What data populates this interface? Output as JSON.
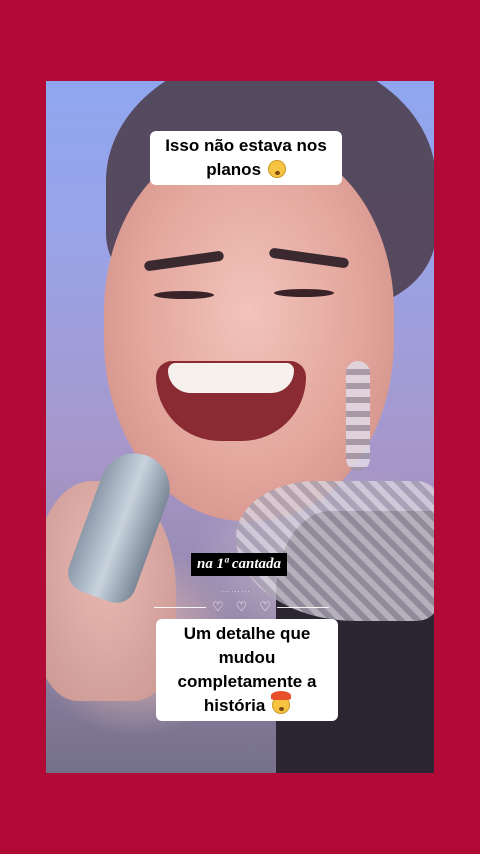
{
  "video": {
    "caption_top": "Isso não estava nos planos",
    "caption_top_emoji": "flushed-face",
    "subtitle": "na 1ª cantada",
    "caption_bottom": "Um detalhe que mudou completamente a história",
    "caption_bottom_emoji": "exploding-head"
  },
  "colors": {
    "background": "#b10a36",
    "caption_bg": "#ffffff"
  }
}
